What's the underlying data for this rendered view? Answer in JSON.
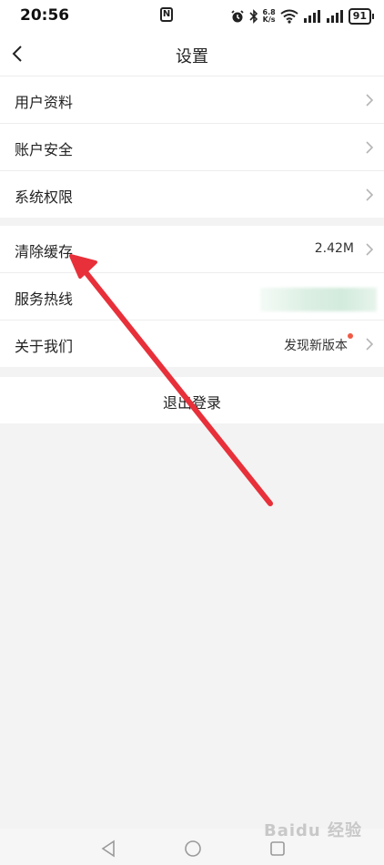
{
  "status_bar": {
    "time": "20:56",
    "nfc": "N",
    "speed_value": "6.8",
    "speed_unit": "K/s",
    "battery": "91"
  },
  "header": {
    "title": "设置"
  },
  "group1": {
    "items": [
      {
        "label": "用户资料"
      },
      {
        "label": "账户安全"
      },
      {
        "label": "系统权限"
      }
    ]
  },
  "group2": {
    "items": [
      {
        "label": "清除缓存",
        "value": "2.42M"
      },
      {
        "label": "服务热线"
      },
      {
        "label": "关于我们",
        "value": "发现新版本"
      }
    ]
  },
  "logout": {
    "label": "退出登录"
  },
  "watermark": "Baidu 经验",
  "colors": {
    "background": "#f3f3f3",
    "accent_dot": "#f05a45",
    "annotation_arrow": "#e8303a"
  },
  "icons": {
    "back": "chevron-left-icon",
    "row_arrow": "chevron-right-icon",
    "nav_back": "triangle-back-icon",
    "nav_home": "circle-home-icon",
    "nav_recent": "square-recent-icon"
  }
}
